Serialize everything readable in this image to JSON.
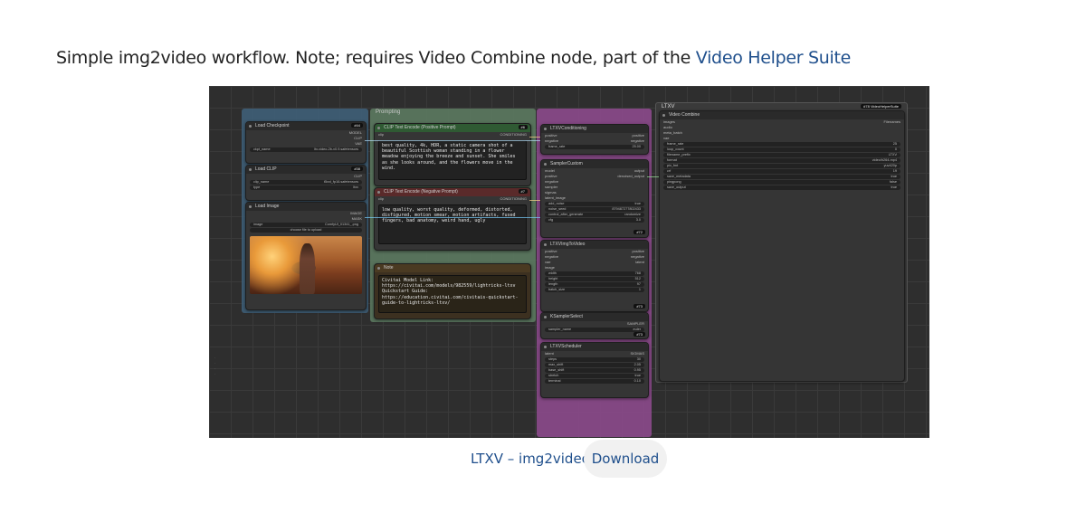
{
  "intro": {
    "text": "Simple img2video workflow. Note; requires Video Combine node, part of the ",
    "link_text": "Video Helper Suite"
  },
  "workflow": {
    "groups": {
      "left": "",
      "prompt": "Prompting",
      "ltxv": "",
      "right": "LTXV"
    },
    "load_checkpoint": {
      "title": "Load Checkpoint",
      "outputs": [
        "MODEL",
        "CLIP",
        "VAE"
      ],
      "ckpt_name_label": "ckpt_name",
      "ckpt_name_value": "ltx-video-2b-v0.9.safetensors",
      "badge": "#44"
    },
    "load_clip": {
      "title": "Load CLIP",
      "output": "CLIP",
      "clip_name_label": "clip_name",
      "clip_name_value": "t5xxl_fp16.safetensors",
      "type_label": "type",
      "type_value": "ltxv",
      "badge": "#38"
    },
    "load_image": {
      "title": "Load Image",
      "outputs": [
        "IMAGE",
        "MASK"
      ],
      "image_label": "image",
      "image_value": "ComfyUI_01341_.png",
      "upload_label": "choose file to upload"
    },
    "clip_positive": {
      "title": "CLIP Text Encode (Positive Prompt)",
      "input": "clip",
      "output": "CONDITIONING",
      "text": "best quality, 4k, HDR, a static camera shot of a beautiful Scottish woman standing in a flower meadow enjoying the breeze and sunset. She smiles as she looks around, and the flowers move in the wind.",
      "badge": "#6"
    },
    "clip_negative": {
      "title": "CLIP Text Encode (Negative Prompt)",
      "input": "clip",
      "output": "CONDITIONING",
      "text": "low quality, worst quality, deformed, distorted, disfigured, motion smear, motion artifacts, fused fingers, bad anatomy, weird hand, ugly",
      "badge": "#7"
    },
    "note": {
      "title": "Note",
      "text": "Civitai Model Link:\nhttps://civitai.com/models/982559/lightricks-ltxv\nQuickstart Guide:\nhttps://education.civitai.com/civitais-quickstart-guide-to-lightricks-ltxv/"
    },
    "ltxv_conditioning": {
      "title": "LTXVConditioning",
      "inputs": [
        "positive",
        "negative"
      ],
      "outputs": [
        "positive",
        "negative"
      ],
      "frame_rate_label": "frame_rate",
      "frame_rate_value": "25.00"
    },
    "sampler_custom": {
      "title": "SamplerCustom",
      "inputs": [
        "model",
        "positive",
        "negative",
        "sampler",
        "sigmas",
        "latent_image"
      ],
      "outputs": [
        "output",
        "denoised_output"
      ],
      "add_noise_label": "add_noise",
      "add_noise_value": "true",
      "noise_seed_label": "noise_seed",
      "noise_seed_value": "879487277802433",
      "control_label": "control_after_generate",
      "control_value": "randomize",
      "cfg_label": "cfg",
      "cfg_value": "3.0",
      "badge": "#72"
    },
    "ltxv_img_to_video": {
      "title": "LTXVImgToVideo",
      "inputs": [
        "positive",
        "negative",
        "vae",
        "image"
      ],
      "outputs": [
        "positive",
        "negative",
        "latent"
      ],
      "width_label": "width",
      "width_value": "768",
      "height_label": "height",
      "height_value": "512",
      "length_label": "length",
      "length_value": "97",
      "batch_label": "batch_size",
      "batch_value": "1",
      "badge": "#73"
    },
    "ksampler_select": {
      "title": "KSamplerSelect",
      "output": "SAMPLER",
      "sampler_label": "sampler_name",
      "sampler_value": "euler",
      "badge": "#73"
    },
    "ltxv_scheduler": {
      "title": "LTXVScheduler",
      "input": "latent",
      "output": "SIGMAS",
      "steps_label": "steps",
      "steps_value": "30",
      "max_shift_label": "max_shift",
      "max_shift_value": "2.05",
      "base_shift_label": "base_shift",
      "base_shift_value": "0.95",
      "stretch_label": "stretch",
      "stretch_value": "true",
      "terminal_label": "terminal",
      "terminal_value": "0.10"
    },
    "video_combine": {
      "title": "Video Combine",
      "badge": "#78 VideoHelperSuite",
      "inputs": [
        "images",
        "audio",
        "meta_batch",
        "vae"
      ],
      "output": "Filenames",
      "rows": [
        {
          "label": "frame_rate",
          "value": "25"
        },
        {
          "label": "loop_count",
          "value": "0"
        },
        {
          "label": "filename_prefix",
          "value": "LTXV"
        },
        {
          "label": "format",
          "value": "video/h264-mp4"
        },
        {
          "label": "pix_fmt",
          "value": "yuv420p"
        },
        {
          "label": "crf",
          "value": "19"
        },
        {
          "label": "save_metadata",
          "value": "true"
        },
        {
          "label": "pingpong",
          "value": "false"
        },
        {
          "label": "save_output",
          "value": "true"
        }
      ]
    }
  },
  "download": {
    "title": "LTXV – img2video",
    "button": "Download"
  }
}
